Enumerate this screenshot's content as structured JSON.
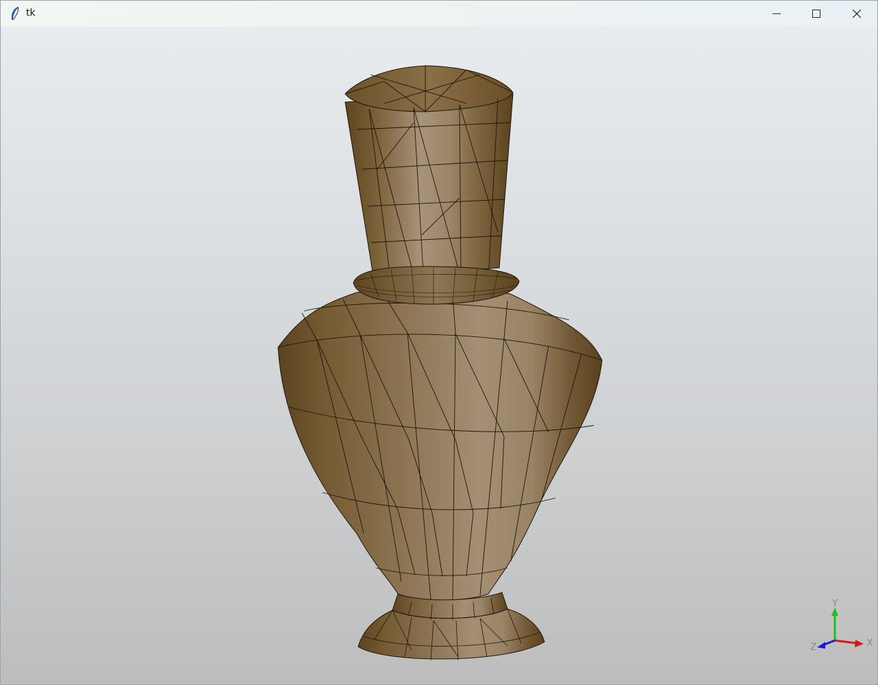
{
  "window": {
    "title": "tk",
    "controls": {
      "minimize_icon": "minimize-icon",
      "maximize_icon": "maximize-icon",
      "close_icon": "close-icon"
    }
  },
  "viewport": {
    "model": "wireframe-shaded-vase",
    "model_color": "#8a7150",
    "axis_triad": {
      "y_label": "Y",
      "x_label": "X",
      "z_label": "Z",
      "colors": {
        "x": "#d11a1a",
        "y": "#1fbf1f",
        "z": "#1a1ad1"
      }
    }
  }
}
